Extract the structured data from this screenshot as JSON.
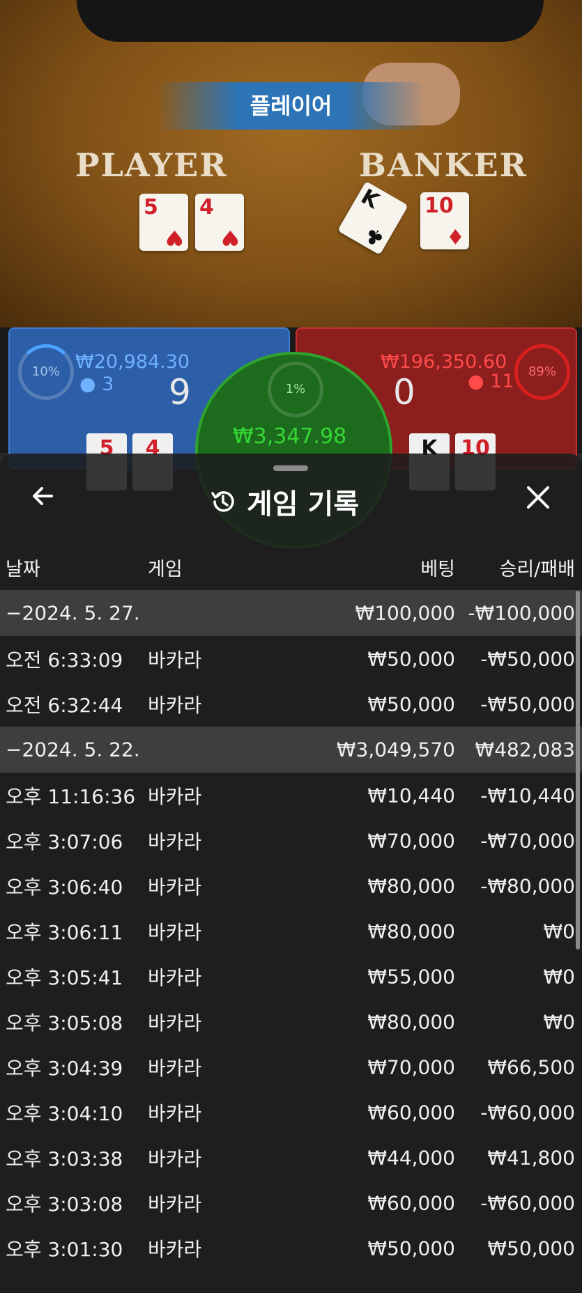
{
  "scene": {
    "result_banner": "플레이어",
    "player_label": "PLAYER",
    "banker_label": "BANKER",
    "player_cards": [
      {
        "rank": "5",
        "suit": "♥"
      },
      {
        "rank": "4",
        "suit": "♥"
      }
    ],
    "banker_cards": [
      {
        "rank": "K",
        "suit": "♣"
      },
      {
        "rank": "10",
        "suit": "♦"
      }
    ],
    "player_bet": {
      "percent": "10%",
      "amount": "₩20,984.30",
      "players": "3",
      "score": "9"
    },
    "banker_bet": {
      "percent": "89%",
      "amount": "₩196,350.60",
      "players": "11",
      "score": "0"
    },
    "tie_bet": {
      "percent": "1%",
      "amount": "₩3,347.98"
    },
    "colors": {
      "player": "#2c5fa8",
      "banker": "#8c1e1e",
      "tie": "#1d6b1d"
    }
  },
  "history": {
    "title": "게임 기록",
    "back_icon": "arrow-left-icon",
    "history_icon": "history-icon",
    "close_icon": "close-icon",
    "columns": {
      "date": "날짜",
      "game": "게임",
      "bet": "베팅",
      "result": "승리/패배"
    },
    "rows": [
      {
        "type": "date",
        "time": "−2024. 5. 27.",
        "game": "",
        "bet": "₩100,000",
        "result": "-₩100,000"
      },
      {
        "type": "entry",
        "time": "오전 6:33:09",
        "game": "바카라",
        "bet": "₩50,000",
        "result": "-₩50,000"
      },
      {
        "type": "entry",
        "time": "오전 6:32:44",
        "game": "바카라",
        "bet": "₩50,000",
        "result": "-₩50,000"
      },
      {
        "type": "date",
        "time": "−2024. 5. 22.",
        "game": "",
        "bet": "₩3,049,570",
        "result": "₩482,083"
      },
      {
        "type": "entry",
        "time": "오후 11:16:36",
        "game": "바카라",
        "bet": "₩10,440",
        "result": "-₩10,440"
      },
      {
        "type": "entry",
        "time": "오후 3:07:06",
        "game": "바카라",
        "bet": "₩70,000",
        "result": "-₩70,000"
      },
      {
        "type": "entry",
        "time": "오후 3:06:40",
        "game": "바카라",
        "bet": "₩80,000",
        "result": "-₩80,000"
      },
      {
        "type": "entry",
        "time": "오후 3:06:11",
        "game": "바카라",
        "bet": "₩80,000",
        "result": "₩0"
      },
      {
        "type": "entry",
        "time": "오후 3:05:41",
        "game": "바카라",
        "bet": "₩55,000",
        "result": "₩0"
      },
      {
        "type": "entry",
        "time": "오후 3:05:08",
        "game": "바카라",
        "bet": "₩80,000",
        "result": "₩0"
      },
      {
        "type": "entry",
        "time": "오후 3:04:39",
        "game": "바카라",
        "bet": "₩70,000",
        "result": "₩66,500"
      },
      {
        "type": "entry",
        "time": "오후 3:04:10",
        "game": "바카라",
        "bet": "₩60,000",
        "result": "-₩60,000"
      },
      {
        "type": "entry",
        "time": "오후 3:03:38",
        "game": "바카라",
        "bet": "₩44,000",
        "result": "₩41,800"
      },
      {
        "type": "entry",
        "time": "오후 3:03:08",
        "game": "바카라",
        "bet": "₩60,000",
        "result": "-₩60,000"
      },
      {
        "type": "entry",
        "time": "오후 3:01:30",
        "game": "바카라",
        "bet": "₩50,000",
        "result": "₩50,000"
      }
    ]
  }
}
